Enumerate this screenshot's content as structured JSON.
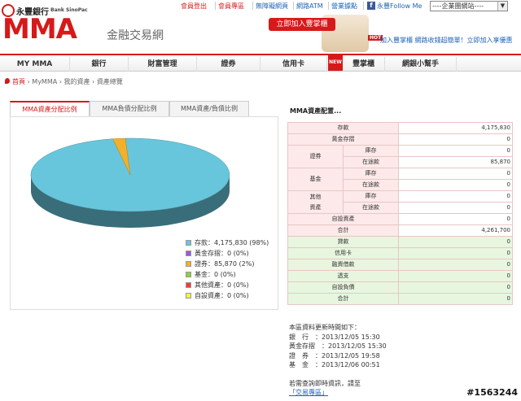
{
  "brand": {
    "name_cn": "永豐銀行",
    "name_en": "Bank SinoPac",
    "logo": "MMA",
    "subtitle": "金融交易網"
  },
  "top_links": [
    "會員登出",
    "會員專區",
    "無障礙網頁",
    "網路ATM",
    "營業據點"
  ],
  "follow": "永豐Follow Me",
  "site_select": "----企業團網站----",
  "join_button": "立即加入豐掌櫃",
  "promo": {
    "badge": "HOT",
    "text": "加入豐掌櫃 網路收錢超簡單！立即加入享優惠"
  },
  "nav": [
    "MY MMA",
    "銀行",
    "財富管理",
    "證券",
    "信用卡",
    "豐掌櫃",
    "網銀小幫手"
  ],
  "nav_badge": "NEW",
  "breadcrumb": [
    "首頁",
    "MyMMA",
    "我的資產",
    "資產總覽"
  ],
  "tabs": [
    "MMA資產分配比例",
    "MMA負債分配比例",
    "MMA資產/負債比例"
  ],
  "config_title": "MMA資產配置...",
  "assets": {
    "deposit": {
      "label": "存款",
      "value": "4,175,830"
    },
    "gold": {
      "label": "黃金存摺",
      "value": "0"
    },
    "securities": {
      "label": "證券",
      "inventory": "庫存",
      "inventory_value": "0",
      "in_transit": "在途款",
      "in_transit_value": "85,870"
    },
    "funds": {
      "label": "基金",
      "inventory": "庫存",
      "inventory_value": "0",
      "in_transit": "在途款",
      "in_transit_value": "0"
    },
    "other": {
      "label1": "其他",
      "label2": "資產",
      "inventory": "庫存",
      "inventory_value": "0",
      "in_transit": "在途款",
      "in_transit_value": "0"
    },
    "custom": {
      "label": "自設資產",
      "value": "0"
    },
    "total": {
      "label": "合計",
      "value": "4,261,700"
    }
  },
  "liabilities": [
    {
      "label": "貸款",
      "value": "0"
    },
    {
      "label": "信用卡",
      "value": "0"
    },
    {
      "label": "融資借款",
      "value": "0"
    },
    {
      "label": "透支",
      "value": "0"
    },
    {
      "label": "自設負債",
      "value": "0"
    },
    {
      "label": "合計",
      "value": "0"
    }
  ],
  "update": {
    "heading": "本區資料更新時間如下：",
    "rows": [
      "銀　行　：2013/12/05 15:30",
      "黃金存摺　：2013/12/05 15:30",
      "證　券　：2013/12/05 19:58",
      "基　金　：2013/12/06 00:51"
    ],
    "note": "若需查詢即時資訊，請至",
    "link": "「交易專區」"
  },
  "watermark": "#1563244",
  "chart_data": {
    "type": "pie",
    "categories": [
      "存款",
      "黃金存摺",
      "證券",
      "基金",
      "其他資產",
      "自設資產"
    ],
    "values": [
      4175830,
      0,
      85870,
      0,
      0,
      0
    ],
    "percent": [
      98,
      0,
      2,
      0,
      0,
      0
    ],
    "legend": [
      "存款：4,175,830 (98%)",
      "黃金存摺：0 (0%)",
      "證券：85,870 (2%)",
      "基金：0 (0%)",
      "其他資產：0 (0%)",
      "自設資產：0 (0%)"
    ],
    "colors": [
      "#68c6dc",
      "#9a5ad6",
      "#f2b12a",
      "#8fcf3c",
      "#e84040",
      "#f5f04a"
    ],
    "legend_position": "bottom-right"
  }
}
